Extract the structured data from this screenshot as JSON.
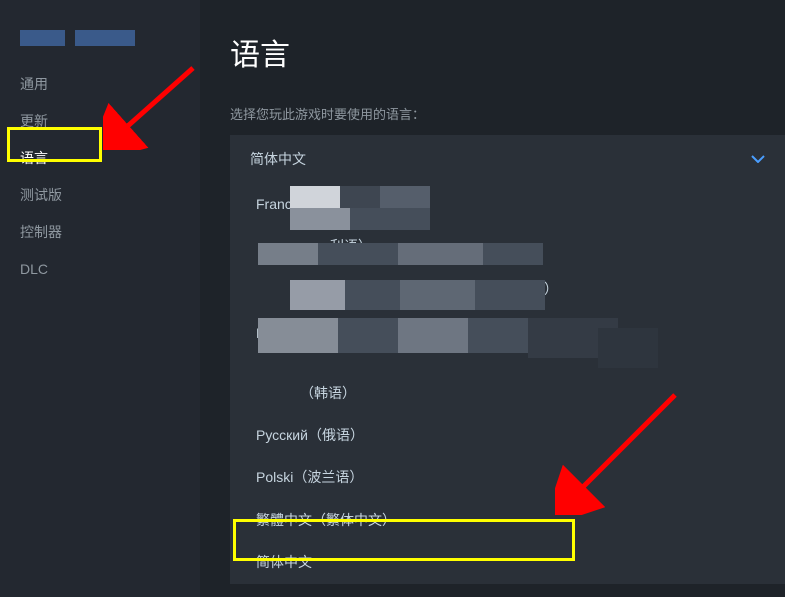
{
  "sidebar": {
    "items": [
      {
        "label": "通用"
      },
      {
        "label": "更新"
      },
      {
        "label": "语言"
      },
      {
        "label": "测试版"
      },
      {
        "label": "控制器"
      },
      {
        "label": "DLC"
      }
    ]
  },
  "main": {
    "title": "语言",
    "instruction": "选择您玩此游戏时要使用的语言：",
    "selected_language": "简体中文",
    "options": [
      {
        "label": "Franca"
      },
      {
        "label": "利语）"
      },
      {
        "label": "牙）"
      },
      {
        "label": "E"
      },
      {
        "label": "（韩语）"
      },
      {
        "label": "Русский（俄语）"
      },
      {
        "label": "Polski（波兰语）"
      },
      {
        "label": "繁體中文（繁体中文）"
      },
      {
        "label": "简体中文"
      }
    ]
  }
}
